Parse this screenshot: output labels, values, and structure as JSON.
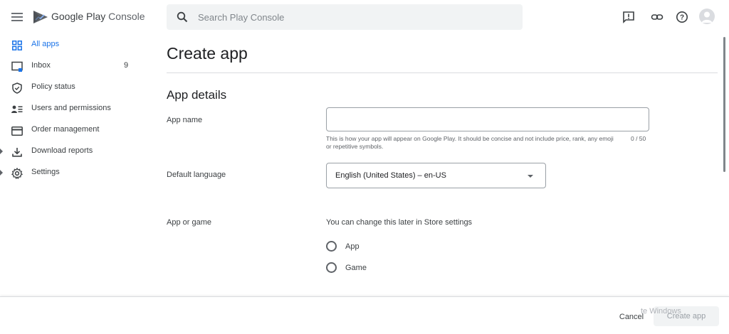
{
  "header": {
    "brand_main": "Google Play",
    "brand_sub": "Console",
    "search_placeholder": "Search Play Console",
    "icons": [
      "menu-icon",
      "play-console-logo",
      "search-icon",
      "feedback-icon",
      "link-icon",
      "help-icon",
      "account-icon"
    ]
  },
  "sidebar": {
    "items": [
      {
        "label": "All apps",
        "icon": "apps-grid-icon",
        "active": true
      },
      {
        "label": "Inbox",
        "icon": "inbox-icon",
        "count": "9"
      },
      {
        "label": "Policy status",
        "icon": "shield-icon"
      },
      {
        "label": "Users and permissions",
        "icon": "users-icon"
      },
      {
        "label": "Order management",
        "icon": "credit-card-icon"
      },
      {
        "label": "Download reports",
        "icon": "download-icon",
        "expandable": true
      },
      {
        "label": "Settings",
        "icon": "gear-icon",
        "expandable": true
      }
    ]
  },
  "main": {
    "title": "Create app",
    "section_title": "App details",
    "app_name": {
      "label": "App name",
      "value": "",
      "hint": "This is how your app will appear on Google Play. It should be concise and not include price, rank, any emoji or repetitive symbols.",
      "char_count": "0 / 50"
    },
    "default_language": {
      "label": "Default language",
      "value": "English (United States) – en-US"
    },
    "app_or_game": {
      "label": "App or game",
      "helper": "You can change this later in Store settings",
      "options": [
        "App",
        "Game"
      ]
    }
  },
  "footer": {
    "cancel_label": "Cancel",
    "create_label": "Create app",
    "watermark": "te Windows"
  },
  "colors": {
    "accent": "#1a73e8",
    "text": "#202124",
    "secondary_text": "#5f6368",
    "border": "#dadce0"
  }
}
